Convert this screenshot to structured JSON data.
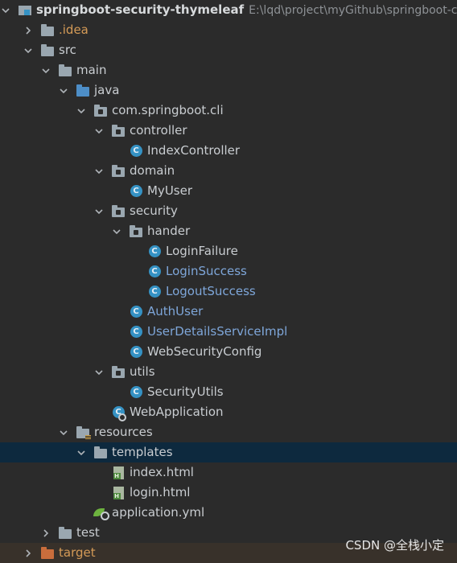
{
  "project": {
    "name": "springboot-security-thymeleaf",
    "path": "E:\\lqd\\project\\myGithub\\springboot-c"
  },
  "tree": {
    "idea": ".idea",
    "src": "src",
    "main": "main",
    "java": "java",
    "package": "com.springboot.cli",
    "controller": "controller",
    "index_controller": "IndexController",
    "domain": "domain",
    "my_user": "MyUser",
    "security": "security",
    "hander": "hander",
    "login_failure": "LoginFailure",
    "login_success": "LoginSuccess",
    "logout_success": "LogoutSuccess",
    "auth_user": "AuthUser",
    "user_details_service_impl": "UserDetailsServiceImpl",
    "web_security_config": "WebSecurityConfig",
    "utils": "utils",
    "security_utils": "SecurityUtils",
    "web_application": "WebApplication",
    "resources": "resources",
    "templates": "templates",
    "index_html": "index.html",
    "login_html": "login.html",
    "application_yml": "application.yml",
    "test": "test",
    "target": "target"
  },
  "class_badge": "C",
  "watermark": "CSDN @全栈小定",
  "colors": {
    "background": "#2b2b2b",
    "selected_row": "#0d293e",
    "modified_blue": "#7ea6d9",
    "excluded_orange": "#d59b57",
    "class_icon": "#3592c4"
  }
}
